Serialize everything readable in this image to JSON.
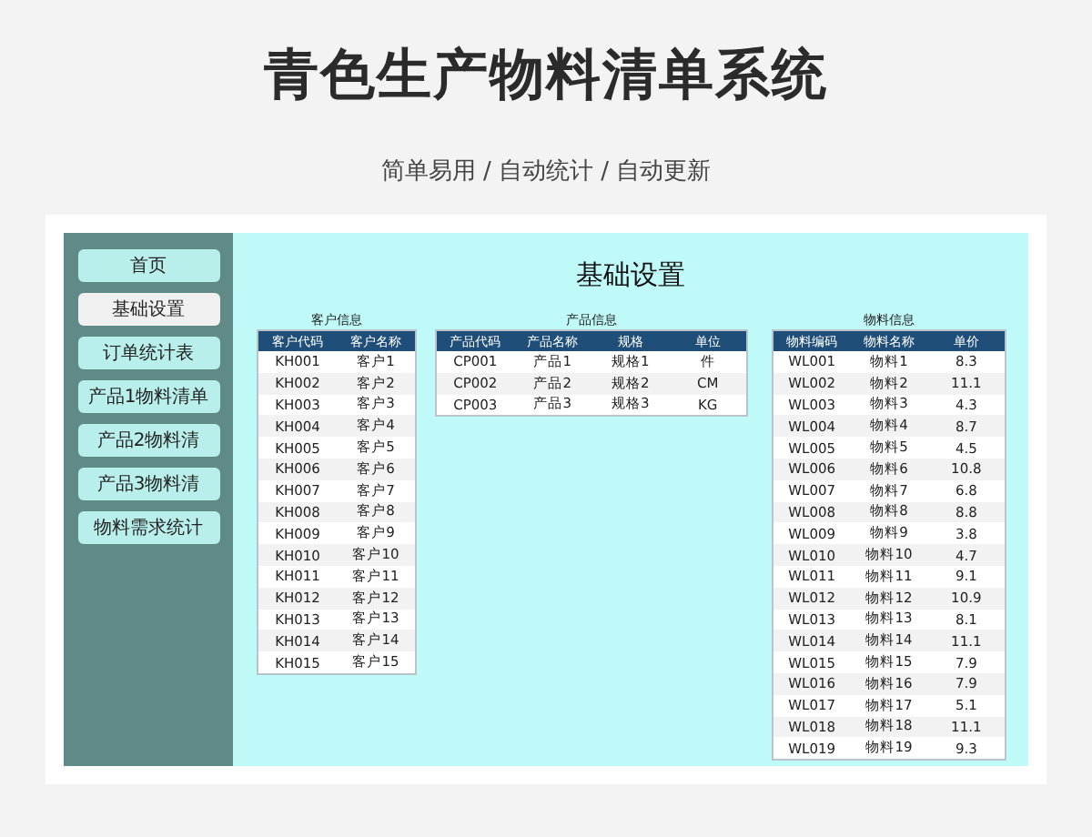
{
  "title": "青色生产物料清单系统",
  "subtitle": "简单易用 / 自动统计 / 自动更新",
  "sidebar": {
    "items": [
      {
        "label": "首页",
        "selected": false
      },
      {
        "label": "基础设置",
        "selected": true
      },
      {
        "label": "订单统计表",
        "selected": false
      },
      {
        "label": "产品1物料清单",
        "selected": false
      },
      {
        "label": "产品2物料清",
        "selected": false
      },
      {
        "label": "产品3物料清",
        "selected": false
      },
      {
        "label": "物料需求统计",
        "selected": false
      }
    ]
  },
  "main": {
    "heading": "基础设置",
    "tables": [
      {
        "caption": "客户信息",
        "columns": [
          "客户代码",
          "客户名称"
        ],
        "rows": [
          [
            "KH001",
            "客户1"
          ],
          [
            "KH002",
            "客户2"
          ],
          [
            "KH003",
            "客户3"
          ],
          [
            "KH004",
            "客户4"
          ],
          [
            "KH005",
            "客户5"
          ],
          [
            "KH006",
            "客户6"
          ],
          [
            "KH007",
            "客户7"
          ],
          [
            "KH008",
            "客户8"
          ],
          [
            "KH009",
            "客户9"
          ],
          [
            "KH010",
            "客户10"
          ],
          [
            "KH011",
            "客户11"
          ],
          [
            "KH012",
            "客户12"
          ],
          [
            "KH013",
            "客户13"
          ],
          [
            "KH014",
            "客户14"
          ],
          [
            "KH015",
            "客户15"
          ]
        ]
      },
      {
        "caption": "产品信息",
        "columns": [
          "产品代码",
          "产品名称",
          "规格",
          "单位"
        ],
        "rows": [
          [
            "CP001",
            "产品1",
            "规格1",
            "件"
          ],
          [
            "CP002",
            "产品2",
            "规格2",
            "CM"
          ],
          [
            "CP003",
            "产品3",
            "规格3",
            "KG"
          ]
        ]
      },
      {
        "caption": "物料信息",
        "columns": [
          "物料编码",
          "物料名称",
          "单价"
        ],
        "rows": [
          [
            "WL001",
            "物料1",
            "8.3"
          ],
          [
            "WL002",
            "物料2",
            "11.1"
          ],
          [
            "WL003",
            "物料3",
            "4.3"
          ],
          [
            "WL004",
            "物料4",
            "8.7"
          ],
          [
            "WL005",
            "物料5",
            "4.5"
          ],
          [
            "WL006",
            "物料6",
            "10.8"
          ],
          [
            "WL007",
            "物料7",
            "6.8"
          ],
          [
            "WL008",
            "物料8",
            "8.8"
          ],
          [
            "WL009",
            "物料9",
            "3.8"
          ],
          [
            "WL010",
            "物料10",
            "4.7"
          ],
          [
            "WL011",
            "物料11",
            "9.1"
          ],
          [
            "WL012",
            "物料12",
            "10.9"
          ],
          [
            "WL013",
            "物料13",
            "8.1"
          ],
          [
            "WL014",
            "物料14",
            "11.1"
          ],
          [
            "WL015",
            "物料15",
            "7.9"
          ],
          [
            "WL016",
            "物料16",
            "7.9"
          ],
          [
            "WL017",
            "物料17",
            "5.1"
          ],
          [
            "WL018",
            "物料18",
            "11.1"
          ],
          [
            "WL019",
            "物料19",
            "9.3"
          ]
        ]
      }
    ]
  }
}
